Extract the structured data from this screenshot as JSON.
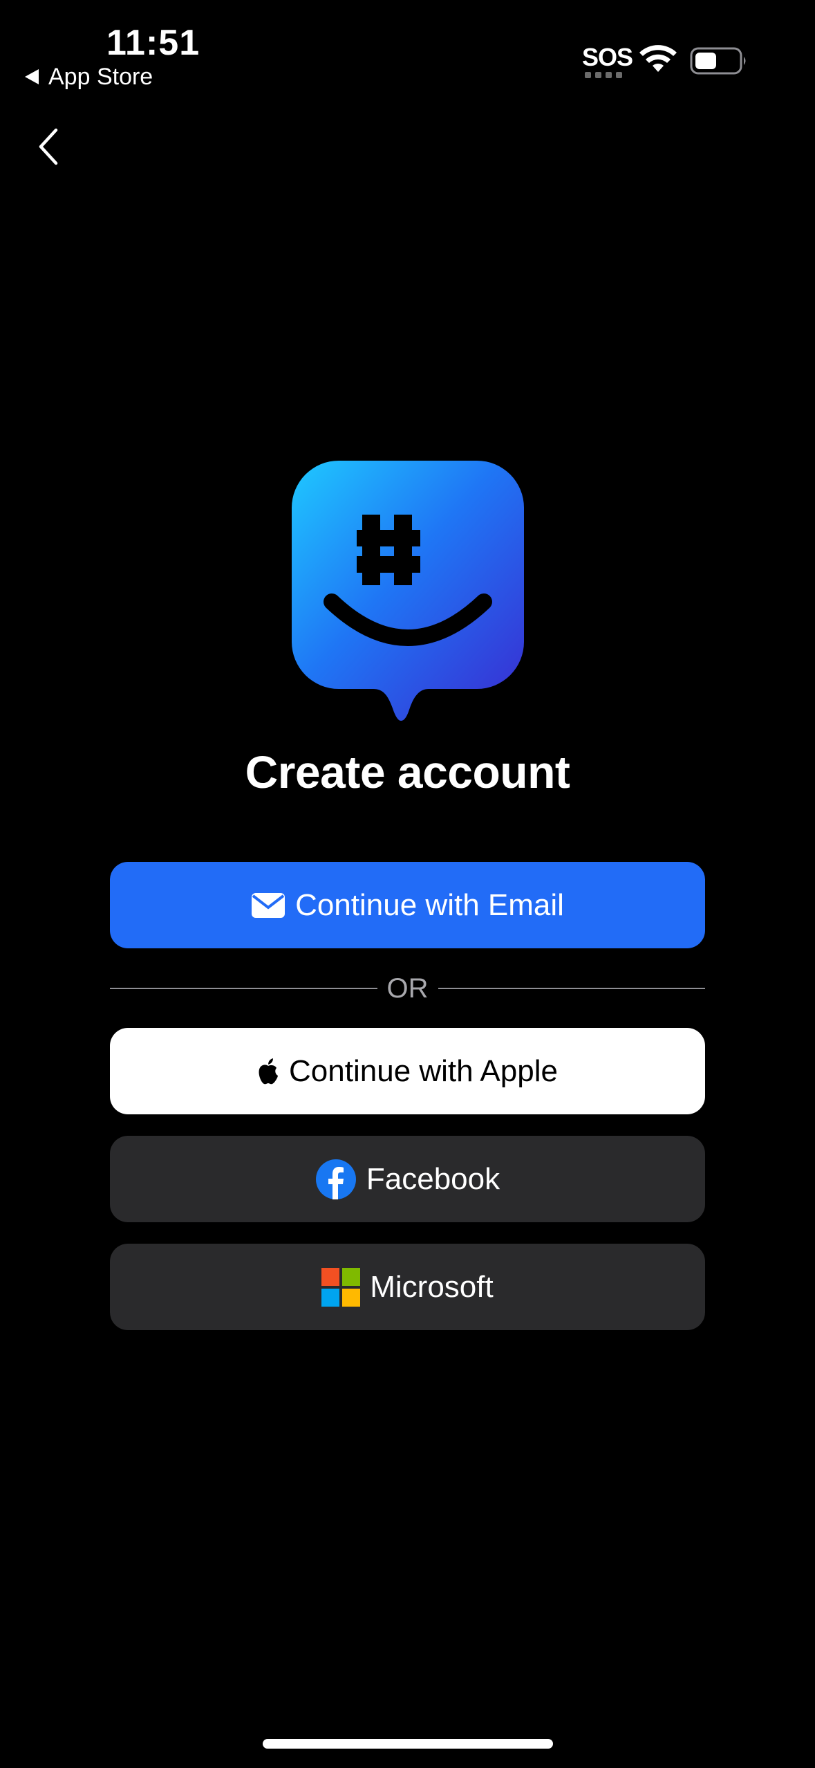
{
  "status_bar": {
    "time": "11:51",
    "back_app": "App Store",
    "sos": "SOS"
  },
  "title": "Create account",
  "buttons": {
    "email": "Continue with Email",
    "or": "OR",
    "apple": "Continue with Apple",
    "facebook": "Facebook",
    "microsoft": "Microsoft"
  },
  "colors": {
    "accent_blue": "#226cf7",
    "dark_button": "#2a2a2c",
    "background": "#000000"
  }
}
